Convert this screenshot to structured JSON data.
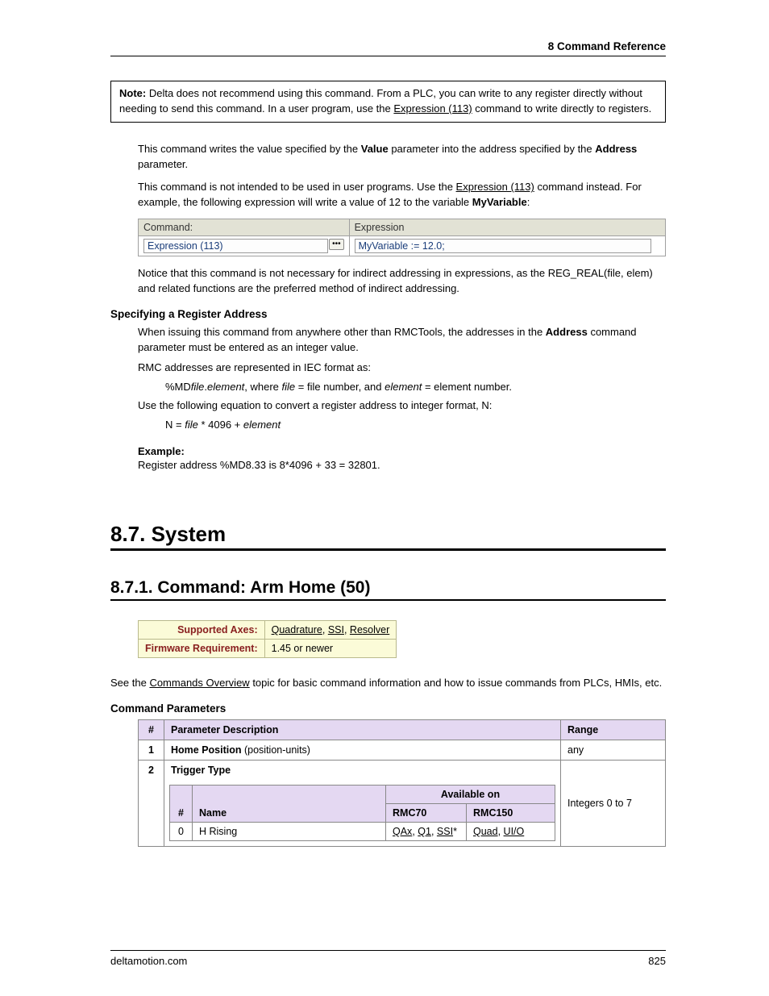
{
  "header": {
    "chapterRef": "8  Command Reference"
  },
  "note": {
    "bold": "Note:",
    "text1": " Delta does not recommend using this command. From a PLC, you can write to any register directly without needing to send this command. In a user program, use the ",
    "link": "Expression (113)",
    "text2": " command to write directly to registers."
  },
  "p1a": "This command writes the value specified by the ",
  "p1b": "Value",
  "p1c": " parameter into the address specified by the ",
  "p1d": "Address",
  "p1e": " parameter.",
  "p2a": "This command is not intended to be used in user programs. Use the ",
  "p2link": "Expression (113)",
  "p2b": " command instead. For example, the following expression will write a value of 12 to the variable ",
  "p2var": "MyVariable",
  "p2c": ":",
  "exprTable": {
    "h1": "Command:",
    "h2": "Expression",
    "c1": "Expression (113)",
    "c2": "MyVariable := 12.0;"
  },
  "p3": "Notice that this command is not necessary for indirect addressing in expressions, as the REG_REAL(file, elem) and related functions are the preferred method of indirect addressing.",
  "sub1": "Specifying a Register Address",
  "p4a": "When issuing this command from anywhere other than RMCTools, the addresses in the ",
  "p4b": "Address",
  "p4c": " command parameter must be entered as an integer value.",
  "p5": "RMC addresses are represented in IEC format as:",
  "iec": {
    "pre": "%MD",
    "fileI": "file",
    "dot": ".",
    "elemI": "element",
    "whereA": ", where ",
    "fileI2": "file",
    "eqA": " = file number, and ",
    "elemI2": "element",
    "eqB": " = element number."
  },
  "p6": "Use the following equation to convert a register address to integer format, N:",
  "eq": {
    "n": "N =  ",
    "file": "file",
    "mid": " * 4096 + ",
    "elem": "element"
  },
  "exLabel": "Example:",
  "exText": "Register address %MD8.33 is 8*4096 + 33 = 32801.",
  "section": "8.7. System",
  "subsection": "8.7.1. Command: Arm Home (50)",
  "info": {
    "r1l": "Supported Axes:",
    "r1links": [
      "Quadrature",
      "SSI",
      "Resolver"
    ],
    "r2l": "Firmware Requirement:",
    "r2v": "1.45 or newer"
  },
  "see": {
    "a": "See the ",
    "link": "Commands Overview",
    "b": " topic for basic command information and how to issue commands from PLCs, HMIs, etc."
  },
  "cmdParamsHead": "Command Parameters",
  "pt": {
    "h_num": "#",
    "h_desc": "Parameter Description",
    "h_range": "Range",
    "r1n": "1",
    "r1d_b": "Home Position",
    "r1d_t": " (position-units)",
    "r1r": "any",
    "r2n": "2",
    "r2d": "Trigger Type",
    "r2r": "Integers 0 to 7",
    "inner": {
      "h_num": "#",
      "h_name": "Name",
      "h_avail": "Available on",
      "h_r70": "RMC70",
      "h_r150": "RMC150",
      "r0n": "0",
      "r0name": "H Rising",
      "r0_70": [
        "QAx",
        "Q1",
        "SSI"
      ],
      "r0_70_suffix": "*",
      "r0_150": [
        "Quad",
        "UI/O"
      ]
    }
  },
  "footer": {
    "left": "deltamotion.com",
    "right": "825"
  }
}
